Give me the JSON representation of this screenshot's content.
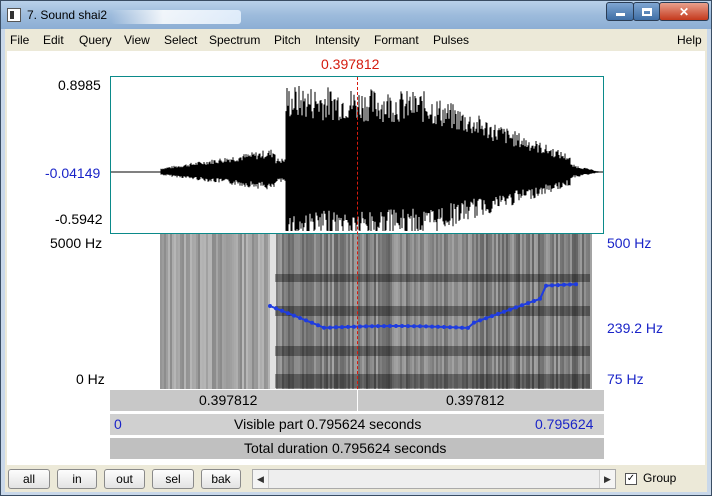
{
  "window": {
    "title": "7. Sound shai2"
  },
  "menu": [
    "File",
    "Edit",
    "Query",
    "View",
    "Select",
    "Spectrum",
    "Pitch",
    "Intensity",
    "Formant",
    "Pulses"
  ],
  "menu_help": "Help",
  "cursor_time": "0.397812",
  "waveform": {
    "top": "0.8985",
    "mid": "-0.04149",
    "bottom": "-0.5942"
  },
  "spectrogram": {
    "freq_top": "5000 Hz",
    "freq_bottom": "0 Hz",
    "pitch_top": "500 Hz",
    "pitch_mid": "239.2 Hz",
    "pitch_bottom": "75 Hz"
  },
  "bars": {
    "left_time": "0.397812",
    "right_time": "0.397812",
    "visible_start": "0",
    "visible_text": "Visible part 0.795624 seconds",
    "visible_end": "0.795624",
    "total_text": "Total duration 0.795624 seconds"
  },
  "buttons": {
    "all": "all",
    "in": "in",
    "out": "out",
    "sel": "sel",
    "bak": "bak"
  },
  "group_label": "Group",
  "group_checked": true,
  "colors": {
    "cursor": "#d41b0e",
    "axis_blue": "#1a24c8",
    "pitch_curve": "#1f3ce0"
  }
}
